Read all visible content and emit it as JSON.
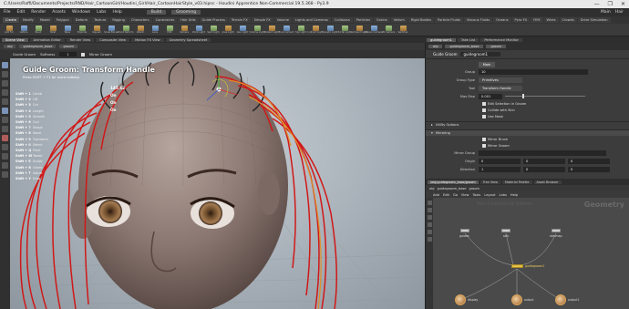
{
  "window": {
    "title": "C:/Users/Raffi/Documents/Projects/RND/Hair_CartoonGirl/Houdini_Girl/Hair_CartoonHairStyle_v03.hipnc - Houdini Apprentice Non-Commercial 19.5.368 - Py3.9",
    "controls": [
      "—",
      "❐",
      "✕"
    ]
  },
  "menu": {
    "items": [
      "File",
      "Edit",
      "Render",
      "Assets",
      "Windows",
      "Labs",
      "Help"
    ],
    "build": "Build",
    "desktop": "Grooming",
    "right_items": [
      "Main",
      "Hair"
    ]
  },
  "shelf_tabs": [
    "Create",
    "Modify",
    "Model",
    "Polygon",
    "Deform",
    "Texture",
    "Rigging",
    "Characters",
    "Constraints",
    "Hair Utils",
    "Guide Process",
    "Terrain FX",
    "Simple FX",
    "Volume",
    "Lights and Cameras",
    "Collisions",
    "Particles",
    "Grains",
    "Vellum",
    "Rigid Bodies",
    "Particle Fluids",
    "Viscous Fluids",
    "Oceans",
    "Pyro FX",
    "FEM",
    "Wires",
    "Crowds",
    "Drive Simulation"
  ],
  "shelf_tools": [
    "Add Fur",
    "Lattice",
    "Bend",
    "Twist",
    "Taper",
    "Explode",
    "Squash",
    "Scale Bones",
    "Point Deform",
    "Attach",
    "Lens",
    "Edit",
    "Camera",
    "Point Light",
    "Spot Light",
    "Area Light",
    "Geo Light",
    "Volume Light",
    "Distant Light",
    "Environment",
    "Sky Light",
    "Indirect Light",
    "Caustic Light",
    "Portal Light",
    "Ambient Light",
    "Stereo Camera",
    "VR Camera",
    "Switcher"
  ],
  "left_tabs": [
    "Scene View",
    "Animation Editor",
    "Render View",
    "Composite View",
    "Motion FX View",
    "Geometry Spreadsheet"
  ],
  "left_path": [
    "obj",
    "guidegroom_base",
    "groom"
  ],
  "viewport_toolbar": {
    "label": "Guide Groom",
    "softness_label": "Softness",
    "softness": "1",
    "mirror_label": "Mirror Groom"
  },
  "hud": {
    "title": "Guide Groom: Transform Handle",
    "hint": "Press SHIFT + F1 for more hotkeys",
    "hotkeys": [
      {
        "key": "Shift + 1",
        "desc": "Comb"
      },
      {
        "key": "Shift + 2",
        "desc": "Lift"
      },
      {
        "key": "Shift + 3",
        "desc": "Cut"
      },
      {
        "key": "Shift + 4",
        "desc": "Length"
      },
      {
        "key": "Shift + 5",
        "desc": "Smooth"
      },
      {
        "key": "Shift + 6",
        "desc": "Curl"
      },
      {
        "key": "Shift + 7",
        "desc": "Shape"
      },
      {
        "key": "Shift + 8",
        "desc": "Move"
      },
      {
        "key": "Shift + 9",
        "desc": "Transform"
      },
      {
        "key": "Shift + 0",
        "desc": "Select"
      },
      {
        "key": "Shift + Q",
        "desc": "Plant"
      },
      {
        "key": "Shift + W",
        "desc": "Tweak"
      },
      {
        "key": "Shift + E",
        "desc": "Sculpt"
      },
      {
        "key": "Shift + R",
        "desc": "Orient"
      },
      {
        "key": "Shift + T",
        "desc": "Adjust"
      },
      {
        "key": "Shift + Y",
        "desc": "Drag"
      }
    ],
    "values": [
      "145.62",
      "On",
      "On",
      "On"
    ]
  },
  "right_tabs": [
    "guidegroom1",
    "Take List",
    "Performance Monitor"
  ],
  "right_path": [
    "obj",
    "guidegroom_base",
    "groom"
  ],
  "params": {
    "node_type": "Guide Groom",
    "node_name": "guidegroom1",
    "tab": "Main",
    "group_label": "Group",
    "group_value": "10",
    "group_type_label": "Group Type",
    "group_type": "Primitives",
    "tool_label": "Tool",
    "tool": "Transform Handle",
    "max_rise_label": "Max Rise",
    "max_rise": "0.001",
    "checks": [
      "Edit Selection in Groom",
      "Collide with Skin",
      "Use Mask"
    ],
    "utility_label": "Utility Options",
    "mirroring_label": "Mirroring",
    "mirror_brush": "Mirror Brush",
    "mirror_groom": "Mirror Groom",
    "mirror_group_label": "Mirror Group",
    "origin_label": "Origin",
    "origin": [
      "0",
      "0",
      "0"
    ],
    "direction_label": "Direction",
    "direction": [
      "1",
      "0",
      "0"
    ]
  },
  "network": {
    "tabs": [
      "/obj/guidegroom_base/groom",
      "Tree View",
      "Material Palette",
      "Asset Browser"
    ],
    "path": [
      "obj",
      "guidegroom_base",
      "groom"
    ],
    "menu": [
      "Add",
      "Edit",
      "Go",
      "View",
      "Tools",
      "Layout",
      "Labs",
      "Help"
    ],
    "watermark": "Non-Commercial Edition",
    "context": "Geometry",
    "nodes": [
      "guides",
      "skin",
      "skinmap",
      "guidegroom1",
      "display",
      "output",
      "output1"
    ]
  }
}
